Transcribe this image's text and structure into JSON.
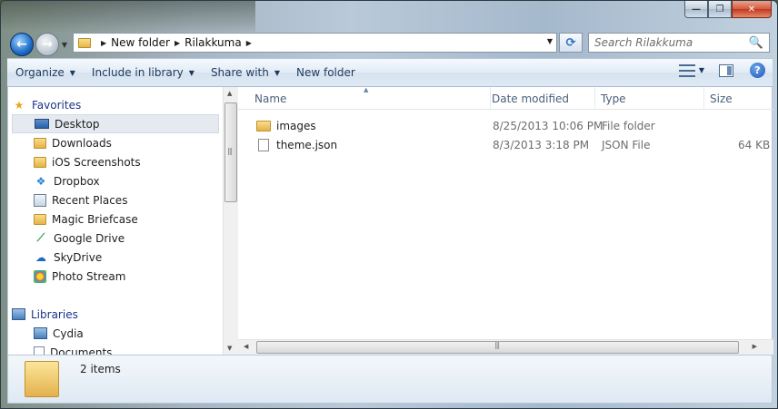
{
  "window": {
    "caption_buttons": [
      "—",
      "❐",
      "✕"
    ]
  },
  "nav": {
    "back_glyph": "←",
    "forward_glyph": "→",
    "recent_glyph": "▼"
  },
  "address": {
    "crumbs": [
      "New folder",
      "Rilakkuma"
    ],
    "separator": "▶",
    "dropdown": "▼"
  },
  "refresh_glyph": "⟳",
  "search": {
    "placeholder": "Search Rilakkuma",
    "icon": "🔍"
  },
  "toolbar": {
    "organize": "Organize",
    "include": "Include in library",
    "share": "Share with",
    "new_folder": "New folder",
    "arrow": "▼",
    "help": "?"
  },
  "sidebar": {
    "favorites": "Favorites",
    "items": [
      {
        "label": "Desktop",
        "icon": "desktop-icon"
      },
      {
        "label": "Downloads",
        "icon": "downloads-folder-icon"
      },
      {
        "label": "iOS Screenshots",
        "icon": "folder-icon"
      },
      {
        "label": "Dropbox",
        "icon": "dropbox-icon"
      },
      {
        "label": "Recent Places",
        "icon": "recent-places-icon"
      },
      {
        "label": "Magic Briefcase",
        "icon": "folder-icon"
      },
      {
        "label": "Google Drive",
        "icon": "google-drive-icon"
      },
      {
        "label": "SkyDrive",
        "icon": "skydrive-icon"
      },
      {
        "label": "Photo Stream",
        "icon": "photo-stream-icon"
      }
    ],
    "libraries": "Libraries",
    "lib_items": [
      {
        "label": "Cydia",
        "icon": "library-icon"
      },
      {
        "label": "Documents",
        "icon": "documents-icon"
      }
    ]
  },
  "columns": {
    "name": "Name",
    "date": "Date modified",
    "type": "Type",
    "size": "Size"
  },
  "files": [
    {
      "name": "images",
      "date": "8/25/2013 10:06 PM",
      "type": "File folder",
      "size": ""
    },
    {
      "name": "theme.json",
      "date": "8/3/2013 3:18 PM",
      "type": "JSON File",
      "size": "64 KB"
    }
  ],
  "details": {
    "count": "2 items"
  },
  "scroll_glyphs": {
    "up": "▲",
    "down": "▼",
    "left": "◀",
    "right": "▶",
    "grip": "|||"
  }
}
